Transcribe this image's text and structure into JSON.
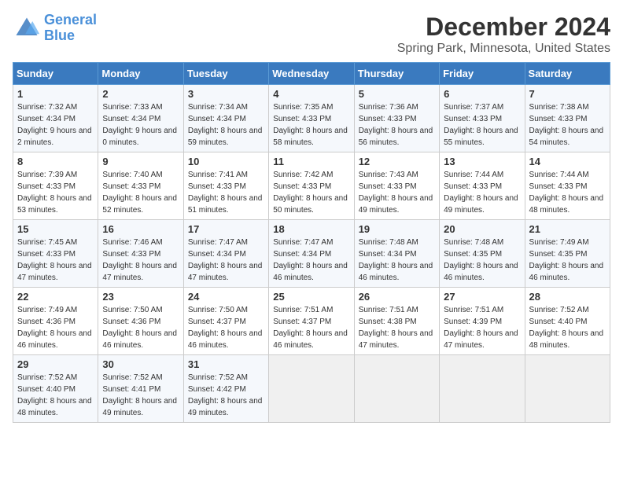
{
  "logo": {
    "line1": "General",
    "line2": "Blue"
  },
  "title": "December 2024",
  "subtitle": "Spring Park, Minnesota, United States",
  "headers": [
    "Sunday",
    "Monday",
    "Tuesday",
    "Wednesday",
    "Thursday",
    "Friday",
    "Saturday"
  ],
  "weeks": [
    [
      {
        "day": "1",
        "sunrise": "7:32 AM",
        "sunset": "4:34 PM",
        "daylight": "9 hours and 2 minutes."
      },
      {
        "day": "2",
        "sunrise": "7:33 AM",
        "sunset": "4:34 PM",
        "daylight": "9 hours and 0 minutes."
      },
      {
        "day": "3",
        "sunrise": "7:34 AM",
        "sunset": "4:34 PM",
        "daylight": "8 hours and 59 minutes."
      },
      {
        "day": "4",
        "sunrise": "7:35 AM",
        "sunset": "4:33 PM",
        "daylight": "8 hours and 58 minutes."
      },
      {
        "day": "5",
        "sunrise": "7:36 AM",
        "sunset": "4:33 PM",
        "daylight": "8 hours and 56 minutes."
      },
      {
        "day": "6",
        "sunrise": "7:37 AM",
        "sunset": "4:33 PM",
        "daylight": "8 hours and 55 minutes."
      },
      {
        "day": "7",
        "sunrise": "7:38 AM",
        "sunset": "4:33 PM",
        "daylight": "8 hours and 54 minutes."
      }
    ],
    [
      {
        "day": "8",
        "sunrise": "7:39 AM",
        "sunset": "4:33 PM",
        "daylight": "8 hours and 53 minutes."
      },
      {
        "day": "9",
        "sunrise": "7:40 AM",
        "sunset": "4:33 PM",
        "daylight": "8 hours and 52 minutes."
      },
      {
        "day": "10",
        "sunrise": "7:41 AM",
        "sunset": "4:33 PM",
        "daylight": "8 hours and 51 minutes."
      },
      {
        "day": "11",
        "sunrise": "7:42 AM",
        "sunset": "4:33 PM",
        "daylight": "8 hours and 50 minutes."
      },
      {
        "day": "12",
        "sunrise": "7:43 AM",
        "sunset": "4:33 PM",
        "daylight": "8 hours and 49 minutes."
      },
      {
        "day": "13",
        "sunrise": "7:44 AM",
        "sunset": "4:33 PM",
        "daylight": "8 hours and 49 minutes."
      },
      {
        "day": "14",
        "sunrise": "7:44 AM",
        "sunset": "4:33 PM",
        "daylight": "8 hours and 48 minutes."
      }
    ],
    [
      {
        "day": "15",
        "sunrise": "7:45 AM",
        "sunset": "4:33 PM",
        "daylight": "8 hours and 47 minutes."
      },
      {
        "day": "16",
        "sunrise": "7:46 AM",
        "sunset": "4:33 PM",
        "daylight": "8 hours and 47 minutes."
      },
      {
        "day": "17",
        "sunrise": "7:47 AM",
        "sunset": "4:34 PM",
        "daylight": "8 hours and 47 minutes."
      },
      {
        "day": "18",
        "sunrise": "7:47 AM",
        "sunset": "4:34 PM",
        "daylight": "8 hours and 46 minutes."
      },
      {
        "day": "19",
        "sunrise": "7:48 AM",
        "sunset": "4:34 PM",
        "daylight": "8 hours and 46 minutes."
      },
      {
        "day": "20",
        "sunrise": "7:48 AM",
        "sunset": "4:35 PM",
        "daylight": "8 hours and 46 minutes."
      },
      {
        "day": "21",
        "sunrise": "7:49 AM",
        "sunset": "4:35 PM",
        "daylight": "8 hours and 46 minutes."
      }
    ],
    [
      {
        "day": "22",
        "sunrise": "7:49 AM",
        "sunset": "4:36 PM",
        "daylight": "8 hours and 46 minutes."
      },
      {
        "day": "23",
        "sunrise": "7:50 AM",
        "sunset": "4:36 PM",
        "daylight": "8 hours and 46 minutes."
      },
      {
        "day": "24",
        "sunrise": "7:50 AM",
        "sunset": "4:37 PM",
        "daylight": "8 hours and 46 minutes."
      },
      {
        "day": "25",
        "sunrise": "7:51 AM",
        "sunset": "4:37 PM",
        "daylight": "8 hours and 46 minutes."
      },
      {
        "day": "26",
        "sunrise": "7:51 AM",
        "sunset": "4:38 PM",
        "daylight": "8 hours and 47 minutes."
      },
      {
        "day": "27",
        "sunrise": "7:51 AM",
        "sunset": "4:39 PM",
        "daylight": "8 hours and 47 minutes."
      },
      {
        "day": "28",
        "sunrise": "7:52 AM",
        "sunset": "4:40 PM",
        "daylight": "8 hours and 48 minutes."
      }
    ],
    [
      {
        "day": "29",
        "sunrise": "7:52 AM",
        "sunset": "4:40 PM",
        "daylight": "8 hours and 48 minutes."
      },
      {
        "day": "30",
        "sunrise": "7:52 AM",
        "sunset": "4:41 PM",
        "daylight": "8 hours and 49 minutes."
      },
      {
        "day": "31",
        "sunrise": "7:52 AM",
        "sunset": "4:42 PM",
        "daylight": "8 hours and 49 minutes."
      },
      null,
      null,
      null,
      null
    ]
  ]
}
